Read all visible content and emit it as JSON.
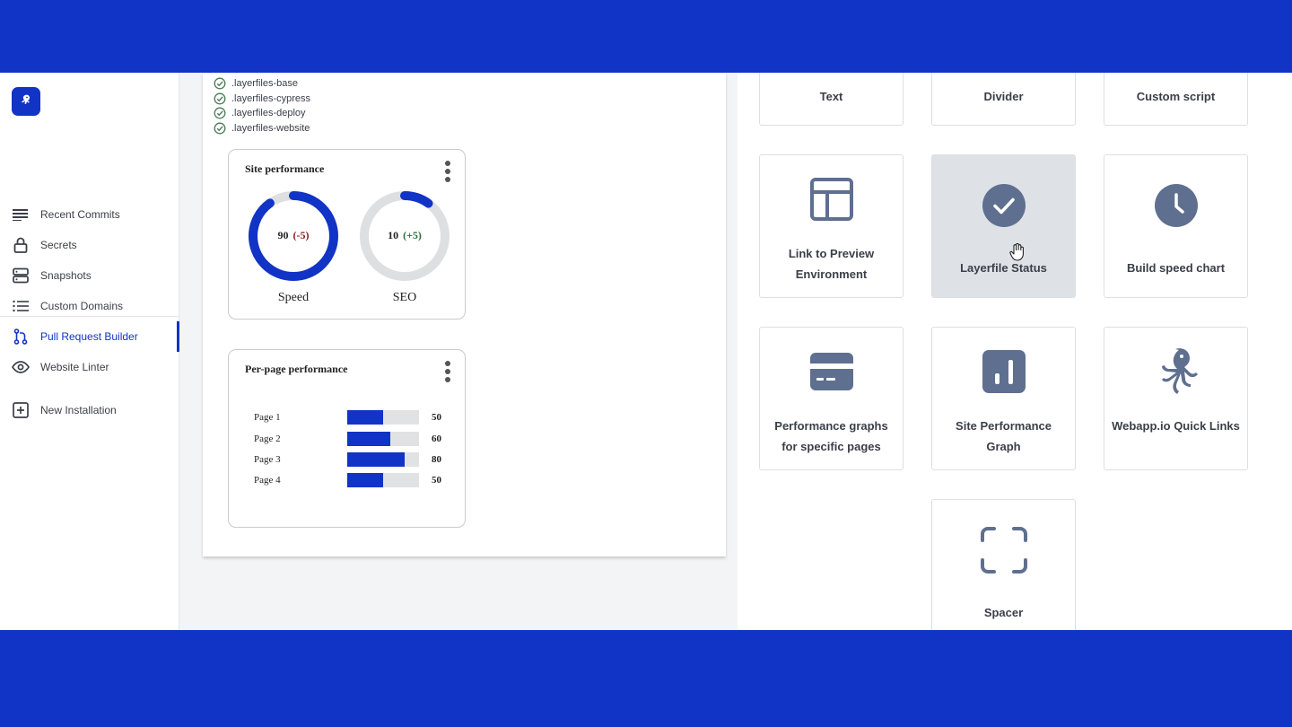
{
  "sidebar": {
    "items": [
      {
        "label": "Recent Commits",
        "icon": "lines-icon"
      },
      {
        "label": "Secrets",
        "icon": "lock-icon"
      },
      {
        "label": "Snapshots",
        "icon": "server-icon"
      },
      {
        "label": "Custom Domains",
        "icon": "list-icon"
      },
      {
        "label": "Pull Request Builder",
        "icon": "git-branch-icon",
        "active": true
      },
      {
        "label": "Website Linter",
        "icon": "eye-icon"
      }
    ],
    "new_installation": "New Installation"
  },
  "layerfiles": [
    ".layerfiles-base",
    ".layerfiles-cypress",
    ".layerfiles-deploy",
    ".layerfiles-website"
  ],
  "site_performance": {
    "title": "Site performance",
    "speed": {
      "value": "90",
      "delta": "(-5)",
      "label": "Speed",
      "score": 90
    },
    "seo": {
      "value": "10",
      "delta": "(+5)",
      "label": "SEO",
      "score": 10
    }
  },
  "per_page": {
    "title": "Per-page performance",
    "rows": [
      {
        "label": "Page 1",
        "value": 50
      },
      {
        "label": "Page 2",
        "value": 60
      },
      {
        "label": "Page 3",
        "value": 80
      },
      {
        "label": "Page 4",
        "value": 50
      }
    ]
  },
  "widgets": {
    "text": "Text",
    "divider": "Divider",
    "custom_script": "Custom script",
    "link_preview": "Link to Preview Environment",
    "layerfile_status": "Layerfile Status",
    "build_speed": "Build speed chart",
    "perf_graphs": "Performance graphs for specific pages",
    "site_perf_graph": "Site Performance Graph",
    "quick_links": "Webapp.io Quick Links",
    "spacer": "Spacer"
  },
  "colors": {
    "brand": "#1134c6",
    "icon": "#5f6f8f",
    "selected": "#dee2e7"
  }
}
